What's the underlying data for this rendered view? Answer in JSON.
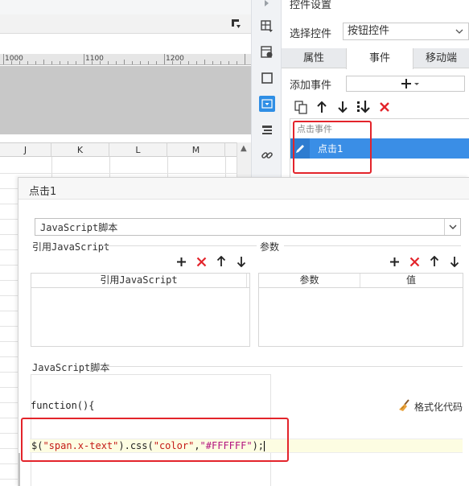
{
  "ruler": {
    "labels": [
      "1000",
      "1100",
      "1200"
    ]
  },
  "grid": {
    "columns": [
      "J",
      "K",
      "L",
      "M"
    ]
  },
  "panel": {
    "title": "控件设置",
    "select_control_label": "选择控件",
    "select_control_value": "按钮控件",
    "tabs": [
      "属性",
      "事件",
      "移动端"
    ],
    "active_tab": "事件",
    "add_event_label": "添加事件",
    "event_type": "点击事件",
    "event_name": "点击1"
  },
  "dialog": {
    "title": "点击1",
    "type_select": "JavaScript脚本",
    "ref_section_label": "引用JavaScript",
    "ref_table_header": "引用JavaScript",
    "params_section_label": "参数",
    "params_headers": [
      "参数",
      "值"
    ],
    "script_section_label": "JavaScript脚本",
    "function_header": "function(){",
    "format_label": "格式化代码",
    "code": {
      "t1": "$(",
      "t2": "\"span.x-text\"",
      "t3": ").css(",
      "t4": "\"color\"",
      "t5": ",",
      "t6": "\"#FFFFFF\"",
      "t7": ");"
    }
  },
  "colors": {
    "accent": "#3a8ee6",
    "highlight_border": "#e3242b",
    "delete_red": "#e3242b",
    "code_line_bg": "#fdfde2"
  }
}
